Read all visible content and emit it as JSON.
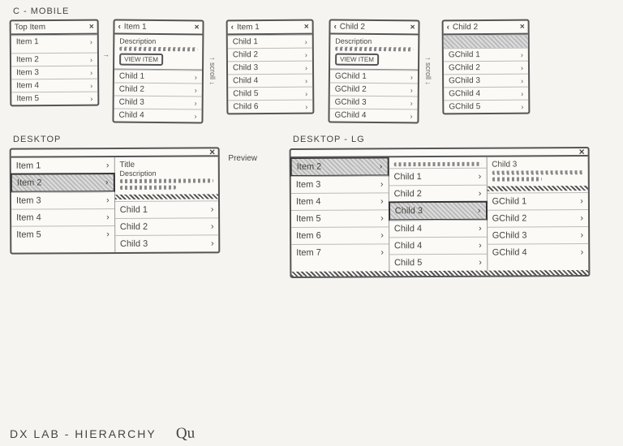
{
  "labels": {
    "mobile_section": "C - MOBILE",
    "desktop_section": "DESKTOP",
    "desktop_lg_section": "DESKTOP - LG",
    "scroll": "scroll",
    "preview": "Preview",
    "footer": "DX LAB - HIERARCHY",
    "signature": "Qu"
  },
  "mobile": {
    "p0": {
      "title": "Top Item",
      "items": [
        "Item 1",
        "Item 2",
        "Item 3",
        "Item 4",
        "Item 5"
      ]
    },
    "p1": {
      "title": "Item 1",
      "desc": "Description",
      "btn": "VIEW ITEM",
      "items": [
        "Child 1",
        "Child 2",
        "Child 3",
        "Child 4"
      ]
    },
    "p2": {
      "title": "Item 1",
      "items": [
        "Child 1",
        "Child 2",
        "Child 3",
        "Child 4",
        "Child 5",
        "Child 6"
      ]
    },
    "p3": {
      "title": "Child 2",
      "desc": "Description",
      "btn": "VIEW ITEM",
      "items": [
        "GChild 1",
        "GChild 2",
        "GChild 3",
        "GChild 4"
      ]
    },
    "p4": {
      "title": "Child 2",
      "items": [
        "GChild 1",
        "GChild 2",
        "GChild 3",
        "GChild 4",
        "GChild 5"
      ]
    }
  },
  "desktop": {
    "col0": [
      "Item 1",
      "Item 2",
      "Item 3",
      "Item 4",
      "Item 5"
    ],
    "selected0": "Item 2",
    "preview_title": "Title",
    "preview_desc": "Description",
    "col1": [
      "Child 1",
      "Child 2",
      "Child 3"
    ]
  },
  "desktop_lg": {
    "col0": [
      "Item 2",
      "Item 3",
      "Item 4",
      "Item 5",
      "Item 6",
      "Item 7"
    ],
    "selected0": "Item 2",
    "col1": [
      "Child 1",
      "Child 2",
      "Child 3",
      "Child 4",
      "Child 4",
      "Child 5"
    ],
    "selected1": "Child 3",
    "col2_preview": "Child 3",
    "col2": [
      "GChild 1",
      "GChild 2",
      "GChild 3",
      "GChild 4"
    ]
  }
}
